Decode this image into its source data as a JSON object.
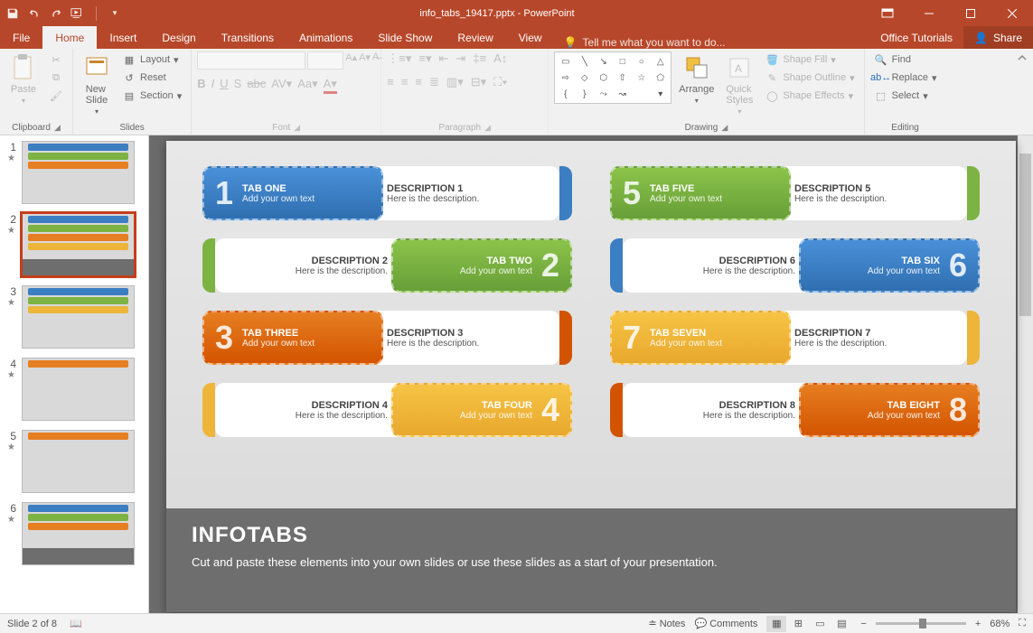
{
  "app": {
    "filename": "info_tabs_19417.pptx",
    "appname": "PowerPoint"
  },
  "tabs": {
    "file": "File",
    "home": "Home",
    "insert": "Insert",
    "design": "Design",
    "transitions": "Transitions",
    "animations": "Animations",
    "slideshow": "Slide Show",
    "review": "Review",
    "view": "View",
    "tellme": "Tell me what you want to do...",
    "officetutorials": "Office Tutorials",
    "share": "Share"
  },
  "ribbon": {
    "clipboard": {
      "paste": "Paste",
      "label": "Clipboard"
    },
    "slides": {
      "newslide": "New\nSlide",
      "layout": "Layout",
      "reset": "Reset",
      "section": "Section",
      "label": "Slides"
    },
    "font": {
      "label": "Font"
    },
    "paragraph": {
      "label": "Paragraph"
    },
    "drawing": {
      "arrange": "Arrange",
      "quickstyles": "Quick\nStyles",
      "shapefill": "Shape Fill",
      "shapeoutline": "Shape Outline",
      "shapeeffects": "Shape Effects",
      "label": "Drawing"
    },
    "editing": {
      "find": "Find",
      "replace": "Replace",
      "select": "Select",
      "label": "Editing"
    }
  },
  "thumbs": {
    "count": 8,
    "selected": 2
  },
  "slide": {
    "tabs": [
      {
        "num": "1",
        "title": "TAB ONE",
        "sub": "Add your own text",
        "desc_t": "DESCRIPTION 1",
        "desc": "Here is the description.",
        "color": "blue",
        "rev": false
      },
      {
        "num": "5",
        "title": "TAB FIVE",
        "sub": "Add your own text",
        "desc_t": "DESCRIPTION 5",
        "desc": "Here is the description.",
        "color": "green",
        "rev": false
      },
      {
        "num": "2",
        "title": "TAB TWO",
        "sub": "Add your own text",
        "desc_t": "DESCRIPTION 2",
        "desc": "Here is the description.",
        "color": "green",
        "rev": true
      },
      {
        "num": "6",
        "title": "TAB SIX",
        "sub": "Add your own text",
        "desc_t": "DESCRIPTION 6",
        "desc": "Here is the description.",
        "color": "blue",
        "rev": true
      },
      {
        "num": "3",
        "title": "TAB THREE",
        "sub": "Add your own text",
        "desc_t": "DESCRIPTION 3",
        "desc": "Here is the description.",
        "color": "dorange",
        "rev": false
      },
      {
        "num": "7",
        "title": "TAB SEVEN",
        "sub": "Add your own text",
        "desc_t": "DESCRIPTION 7",
        "desc": "Here is the description.",
        "color": "yellow",
        "rev": false
      },
      {
        "num": "4",
        "title": "TAB FOUR",
        "sub": "Add your own text",
        "desc_t": "DESCRIPTION 4",
        "desc": "Here is the description.",
        "color": "yellow",
        "rev": true
      },
      {
        "num": "8",
        "title": "TAB EIGHT",
        "sub": "Add your own text",
        "desc_t": "DESCRIPTION 8",
        "desc": "Here is the description.",
        "color": "dorange",
        "rev": true
      }
    ],
    "footer_title": "INFOTABS",
    "footer_text": "Cut and paste these elements into your own slides or use these slides as a start of your presentation."
  },
  "status": {
    "slide_of": "Slide 2 of 8",
    "notes": "Notes",
    "comments": "Comments",
    "zoom": "68%"
  }
}
